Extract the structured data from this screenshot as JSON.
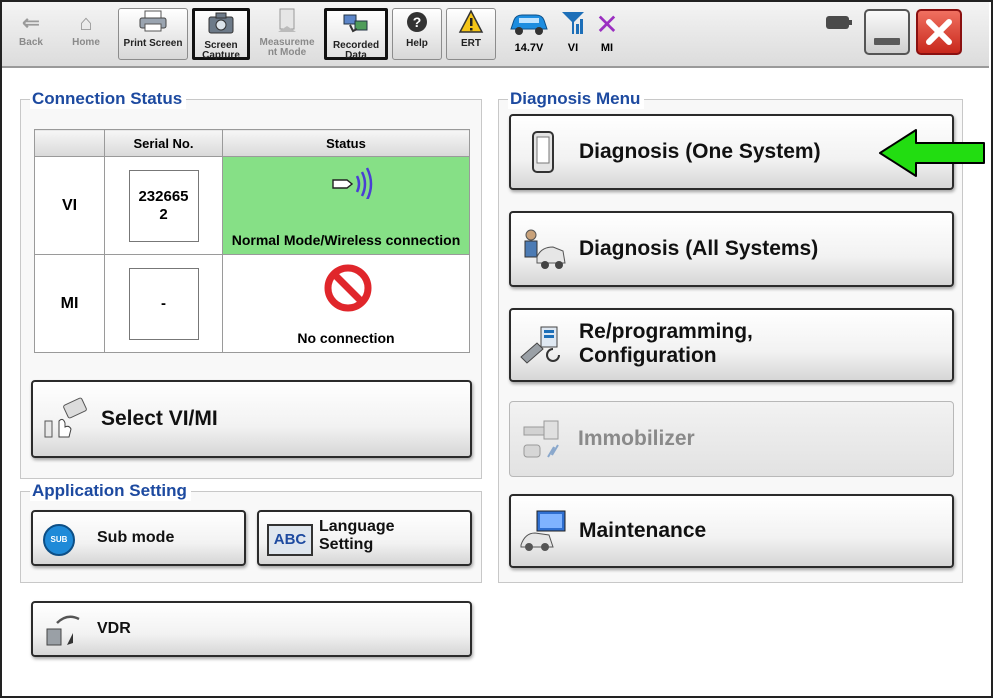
{
  "toolbar": {
    "back": "Back",
    "home": "Home",
    "print_screen": "Print Screen",
    "screen_capture": "Screen Capture",
    "measurement_mode": "Measureme nt Mode",
    "recorded_data": "Recorded Data",
    "help": "Help",
    "ert": "ERT",
    "voltage": "14.7V",
    "vi": "VI",
    "mi": "MI"
  },
  "connection_status": {
    "title": "Connection Status",
    "col_serial": "Serial No.",
    "col_status": "Status",
    "rows": [
      {
        "label": "VI",
        "serial_line1": "232665",
        "serial_line2": "2",
        "status": "Normal Mode/Wireless connection"
      },
      {
        "label": "MI",
        "serial_line1": "-",
        "serial_line2": "",
        "status": "No connection"
      }
    ],
    "select_button": "Select VI/MI"
  },
  "application_setting": {
    "title": "Application Setting",
    "sub_mode": "Sub mode",
    "sub_badge": "SUB",
    "language_line1": "Language",
    "language_line2": "Setting",
    "abc_badge": "ABC"
  },
  "vdr": {
    "label": "VDR"
  },
  "diagnosis_menu": {
    "title": "Diagnosis Menu",
    "one_system": "Diagnosis (One System)",
    "all_systems": "Diagnosis (All Systems)",
    "reprog_line1": "Re/programming,",
    "reprog_line2": "Configuration",
    "immobilizer": "Immobilizer",
    "maintenance": "Maintenance"
  },
  "colors": {
    "title_blue": "#1d4aa0",
    "status_ok_green": "#86e086",
    "arrow_green": "#22dd11",
    "no_connection_red": "#e0262b"
  },
  "icons": [
    "back-arrow-icon",
    "home-icon",
    "printer-icon",
    "camera-icon",
    "gauge-icon",
    "recorded-data-icon",
    "help-icon",
    "warning-icon",
    "car-battery-icon",
    "vi-signal-icon",
    "mi-disconnected-icon",
    "battery-icon",
    "wireless-icon",
    "no-entry-icon",
    "pointing-arrow-icon"
  ]
}
